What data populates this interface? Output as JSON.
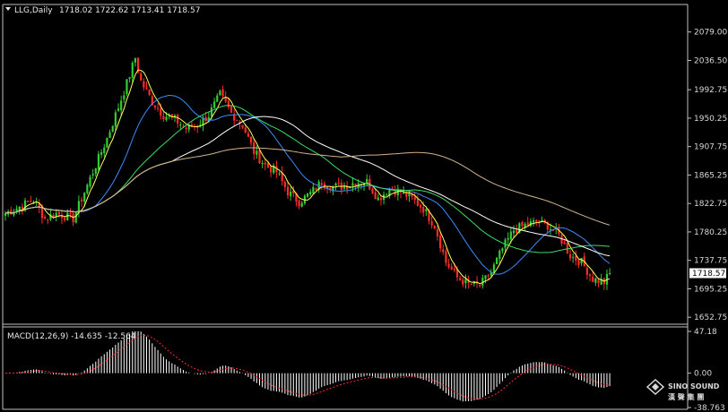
{
  "header": {
    "symbol": "LLG,Daily",
    "ohlc": "1718.02 1722.62 1713.41 1718.57"
  },
  "macd_header": "MACD(12,26,9) -14.635 -12.564",
  "price_label": "1718.57",
  "watermark": {
    "brand": "SINO SOUND",
    "cn": "漢 聲 集 團"
  },
  "colors": {
    "background": "#000000",
    "axis": "#c0c0c0",
    "up": "#32cd32",
    "down": "#ff2a2a",
    "ma5": "#ffff5a",
    "ma20": "#3c8cff",
    "ma40": "#3cdc64",
    "ma60": "#ffffff",
    "ma120": "#d2b48c",
    "macd_hist": "#ffffff",
    "macd_signal": "#ff2a2a"
  },
  "chart_data": [
    {
      "type": "candlestick",
      "ylim": [
        1645,
        2100
      ],
      "yticks": [
        2079.0,
        2036.5,
        1992.75,
        1950.25,
        1907.75,
        1865.25,
        1822.75,
        1780.25,
        1737.75,
        1695.25,
        1652.75
      ],
      "anchors": [
        [
          0,
          1808
        ],
        [
          6,
          1820
        ],
        [
          10,
          1828
        ],
        [
          14,
          1800
        ],
        [
          18,
          1808
        ],
        [
          24,
          1800
        ],
        [
          30,
          1860
        ],
        [
          36,
          1920
        ],
        [
          42,
          1990
        ],
        [
          46,
          2040
        ],
        [
          48,
          2005
        ],
        [
          52,
          1975
        ],
        [
          56,
          1955
        ],
        [
          60,
          1948
        ],
        [
          64,
          1935
        ],
        [
          68,
          1940
        ],
        [
          72,
          1955
        ],
        [
          76,
          1985
        ],
        [
          80,
          1958
        ],
        [
          84,
          1940
        ],
        [
          88,
          1900
        ],
        [
          92,
          1880
        ],
        [
          96,
          1870
        ],
        [
          100,
          1840
        ],
        [
          104,
          1825
        ],
        [
          108,
          1838
        ],
        [
          112,
          1855
        ],
        [
          116,
          1848
        ],
        [
          120,
          1848
        ],
        [
          124,
          1855
        ],
        [
          128,
          1855
        ],
        [
          132,
          1830
        ],
        [
          136,
          1845
        ],
        [
          140,
          1840
        ],
        [
          144,
          1830
        ],
        [
          148,
          1815
        ],
        [
          152,
          1790
        ],
        [
          156,
          1735
        ],
        [
          160,
          1712
        ],
        [
          164,
          1702
        ],
        [
          168,
          1700
        ],
        [
          172,
          1720
        ],
        [
          176,
          1755
        ],
        [
          180,
          1783
        ],
        [
          184,
          1790
        ],
        [
          188,
          1795
        ],
        [
          192,
          1790
        ],
        [
          196,
          1775
        ],
        [
          200,
          1745
        ],
        [
          204,
          1735
        ],
        [
          208,
          1710
        ],
        [
          212,
          1705
        ],
        [
          214,
          1718.57
        ]
      ],
      "moving_averages": [
        {
          "period": 5
        },
        {
          "period": 20
        },
        {
          "period": 40
        },
        {
          "period": 60
        },
        {
          "period": 120
        }
      ]
    },
    {
      "type": "macd",
      "ylim": [
        -38.763,
        47.18
      ],
      "yticks": [
        47.18,
        0.0,
        -38.763
      ],
      "ytick_labels": [
        "47.18",
        "0.00",
        "-38.763"
      ],
      "macd": -14.635,
      "signal": -12.564
    }
  ]
}
